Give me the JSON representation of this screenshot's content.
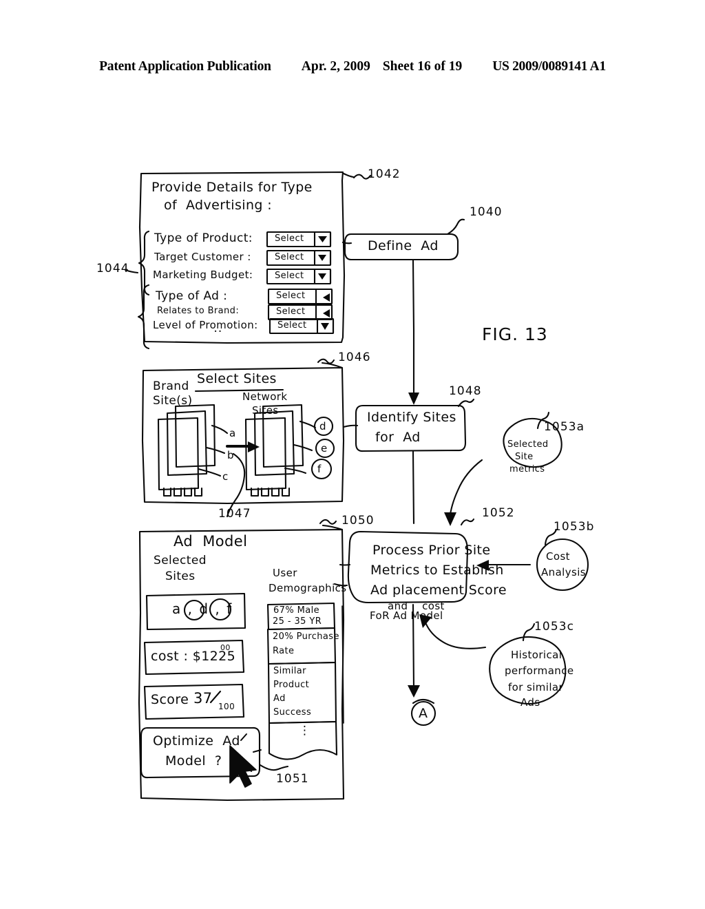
{
  "header": {
    "publication": "Patent Application Publication",
    "date": "Apr. 2, 2009",
    "sheet": "Sheet 16 of 19",
    "number": "US 2009/0089141 A1"
  },
  "figure": {
    "label": "FIG. 13"
  },
  "form_1042": {
    "ref": "1042",
    "title_line1": "Provide Details for Type",
    "title_line2": "of  Advertising :",
    "brace_ref": "1044",
    "group1": [
      {
        "label": "Type of Product:",
        "value": "Select"
      },
      {
        "label": "Target Customer :",
        "value": "Select"
      },
      {
        "label": "Marketing Budget:",
        "value": "Select"
      }
    ],
    "group2": [
      {
        "label": "Type of Ad :",
        "value": "Select"
      },
      {
        "label": "Relates to Brand:",
        "value": "Select"
      },
      {
        "label": "Level of Promotion:",
        "value": "Select"
      }
    ],
    "ellipsis": ":"
  },
  "define_ad": {
    "ref": "1040",
    "label": "Define  Ad"
  },
  "select_sites_1046": {
    "ref": "1046",
    "title": "Select Sites",
    "brand_label_line1": "Brand",
    "brand_label_line2": "Site(s)",
    "network_label_line1": "Network",
    "network_label_line2": "Sites",
    "brand_tags": [
      "a",
      "b",
      "c"
    ],
    "network_tags": [
      "d",
      "e",
      "f"
    ],
    "arrow_ref": "1047"
  },
  "identify_sites_1048": {
    "ref": "1048",
    "line1": "Identify Sites",
    "line2": "for  Ad"
  },
  "ad_model_1050": {
    "ref": "1050",
    "title": "Ad  Model",
    "selected_sites_line1": "Selected",
    "selected_sites_line2": "Sites",
    "selected_sites_value": "a , d , f",
    "cost": "cost : $1225",
    "cost_sup": "00",
    "score_label": "Score",
    "score_value": "37",
    "score_denom": "100",
    "optimize_line1": "Optimize  Ad",
    "optimize_line2": "Model  ?",
    "cursor_ref": "1051",
    "demographics_header_line1": "User",
    "demographics_header_line2": "Demographics",
    "demographics": [
      {
        "line1": "67% Male",
        "line2": "25 - 35 YR"
      },
      {
        "line1": "20% Purchase",
        "line2": "Rate"
      },
      {
        "line1": "Similar",
        "line2": "Product",
        "line3": "Ad",
        "line4": "Success"
      }
    ],
    "demographics_ellipsis": "⋮"
  },
  "process_1052": {
    "ref": "1052",
    "line1": "Process Prior Site",
    "line2": "Metrics to Establish",
    "line3": "Ad placement Score",
    "line4": "and    cost",
    "line5": "FoR Ad Model"
  },
  "inputs": [
    {
      "ref": "1053a",
      "line1": "Selected",
      "line2": "Site",
      "line3": "metrics"
    },
    {
      "ref": "1053b",
      "line1": "Cost",
      "line2": "Analysis"
    },
    {
      "ref": "1053c",
      "line1": "Historical",
      "line2": "performance",
      "line3": "for similar",
      "line4": "Ads"
    }
  ],
  "connector": {
    "label": "A"
  },
  "colors": {
    "ink": "#0a0a0a",
    "paper": "#ffffff"
  }
}
